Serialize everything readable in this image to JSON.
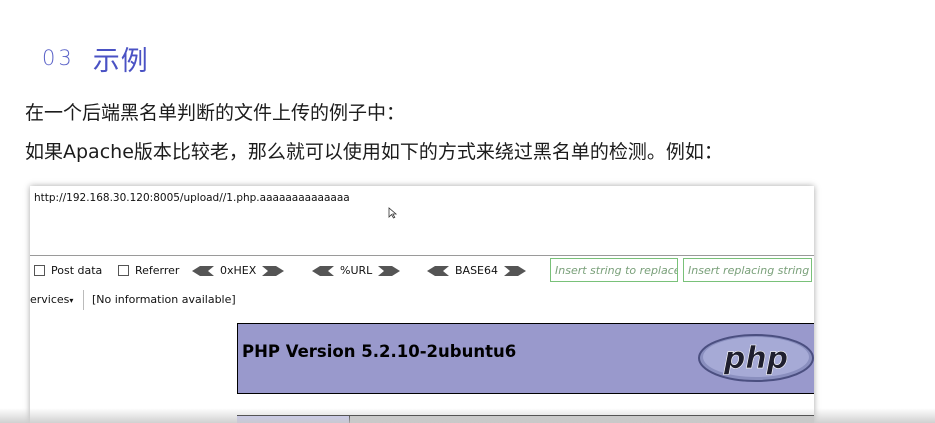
{
  "section": {
    "number": "03",
    "title": "示例"
  },
  "paragraphs": [
    "在一个后端黑名单判断的文件上传的例子中：",
    "如果Apache版本比较老，那么就可以使用如下的方式来绕过黑名单的检测。例如："
  ],
  "screenshot": {
    "url": "http://192.168.30.120:8005/upload//1.php.aaaaaaaaaaaaaa",
    "toolbar": {
      "post_data": "Post data",
      "referrer": "Referrer",
      "hex": "0xHEX",
      "url": "%URL",
      "base64": "BASE64",
      "replace_placeholder": "Insert string to replace",
      "replacing_placeholder": "Insert replacing string"
    },
    "services_label": "ervices",
    "services_info": "[No information available]",
    "php_version": "PHP Version 5.2.10-2ubuntu6",
    "php_logo_text": "php",
    "colors": {
      "php_header": "#9999cc",
      "php_row": "#ccccff",
      "field_border": "#79c179",
      "accent": "#4a52c4"
    }
  }
}
